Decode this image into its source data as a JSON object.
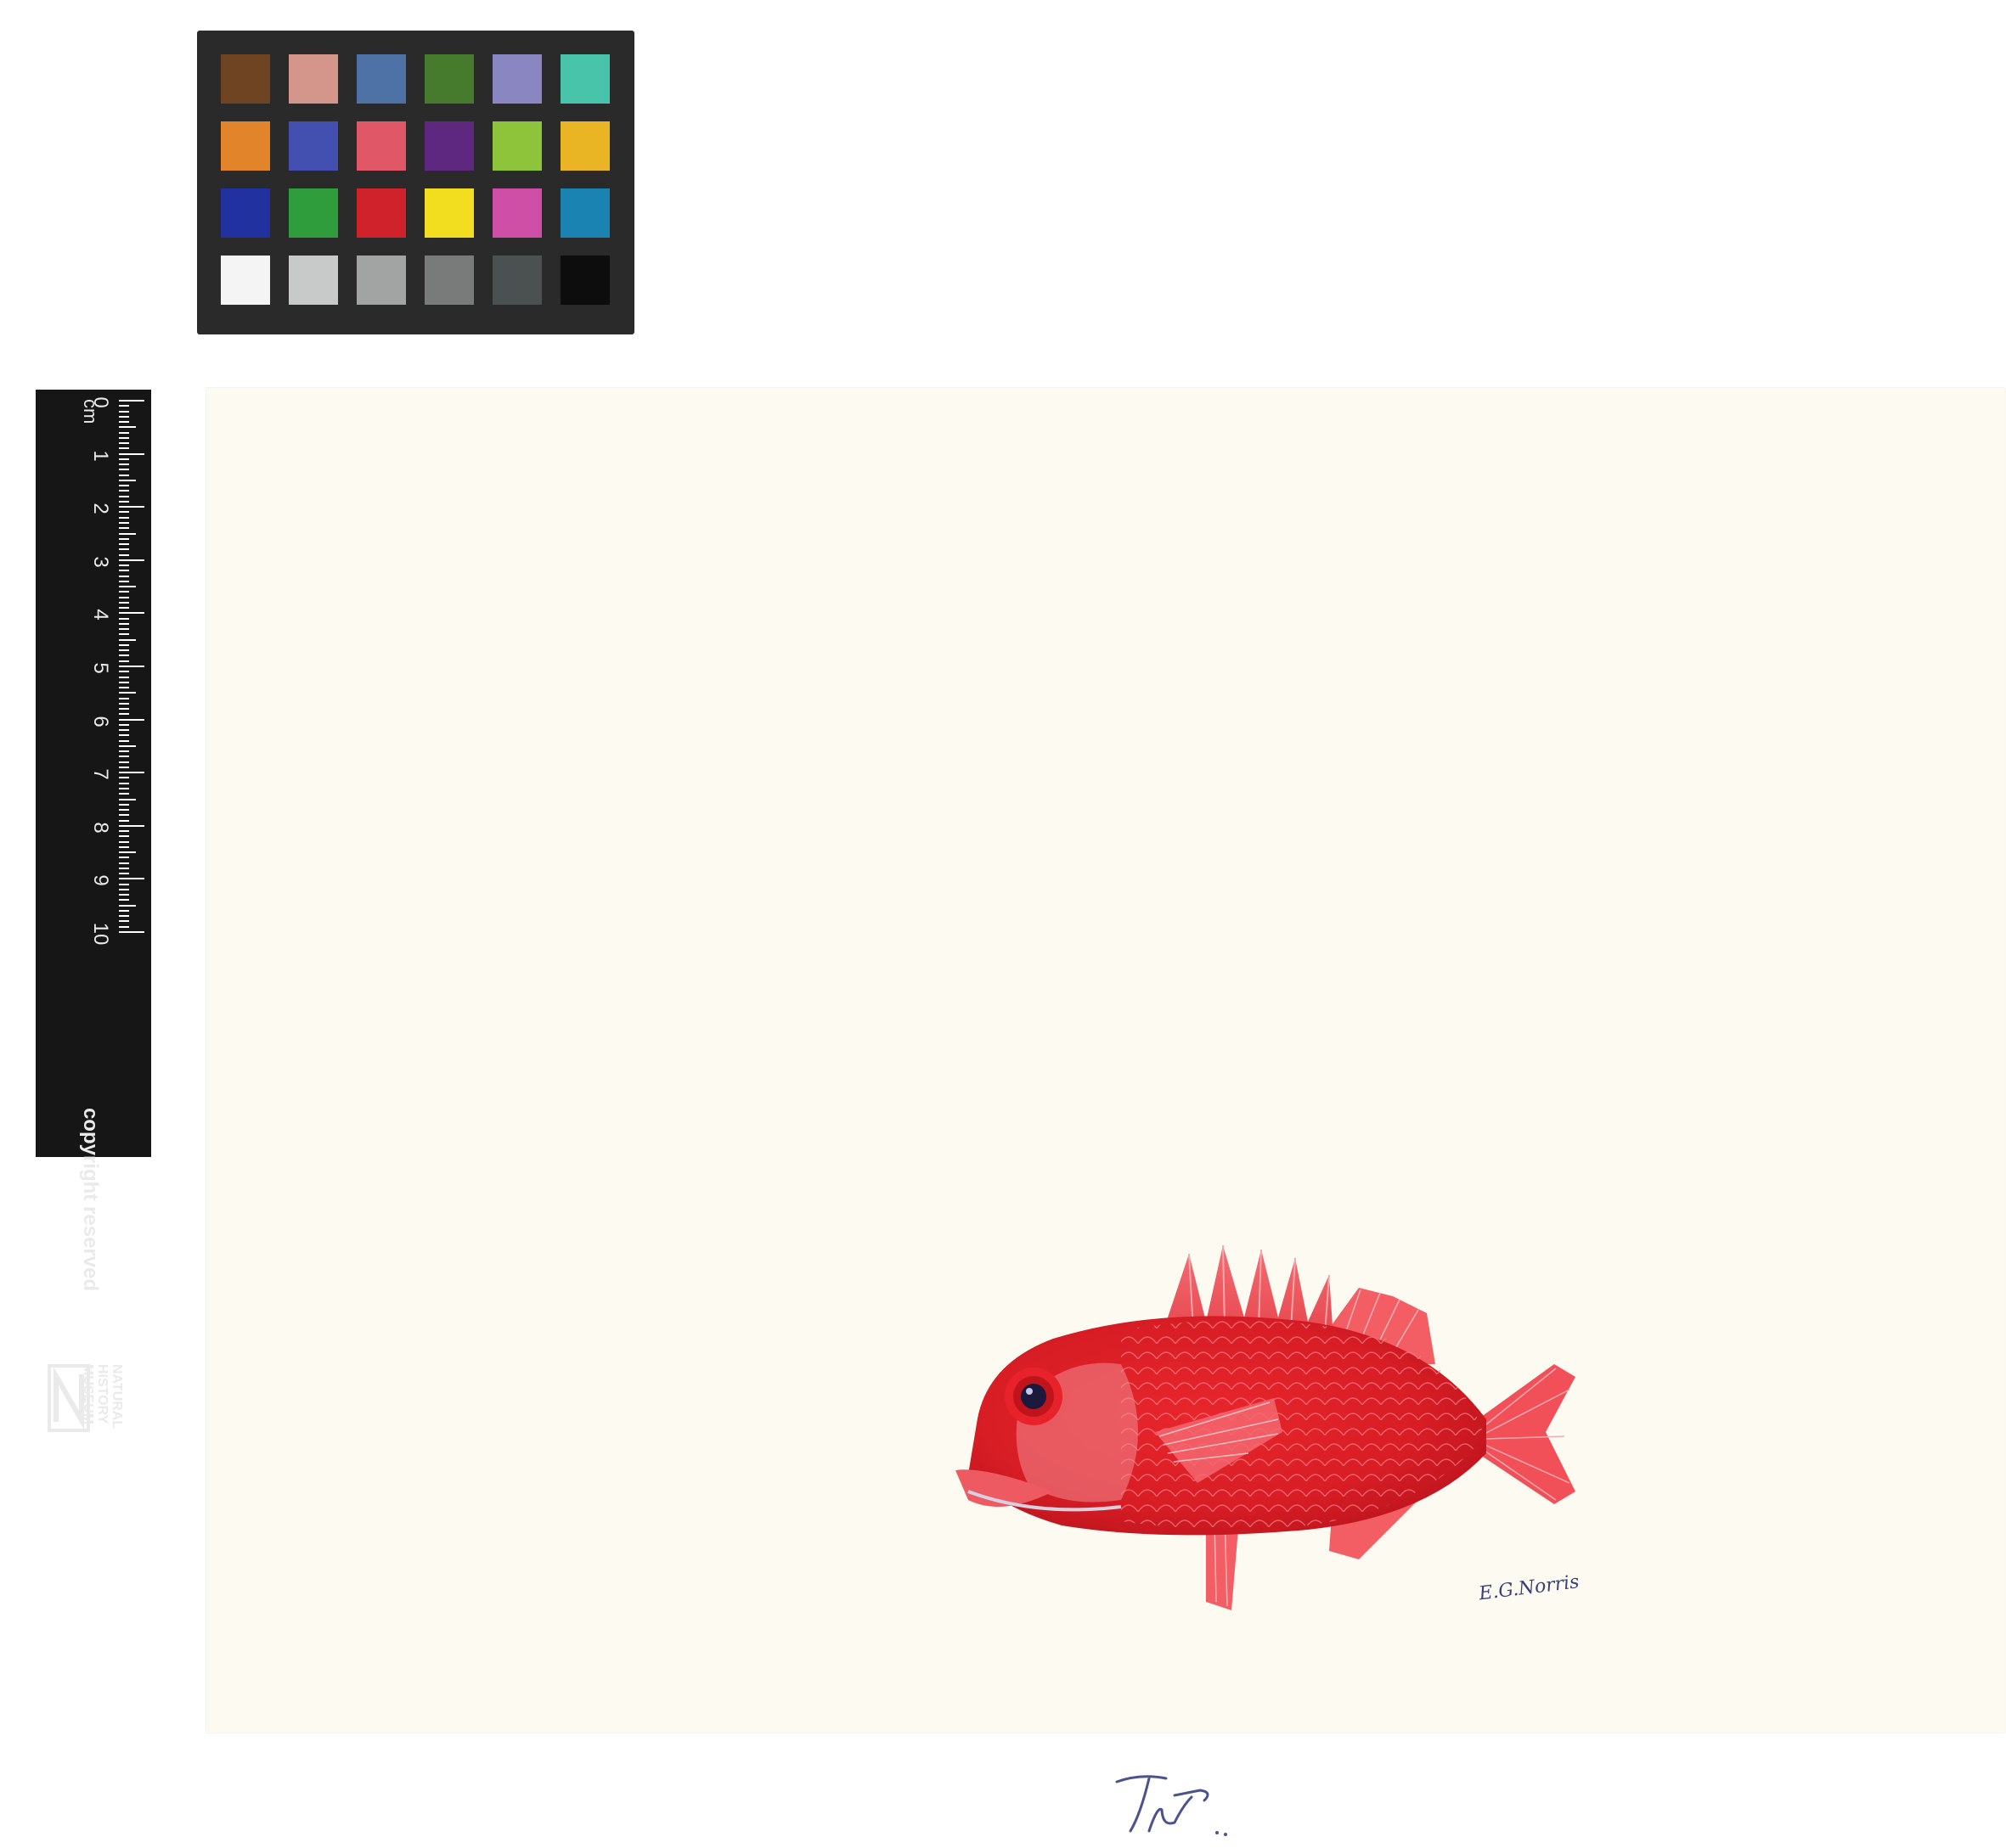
{
  "color_checker": {
    "swatches": [
      "#6f4422",
      "#d4958a",
      "#4f72a6",
      "#467a2c",
      "#8a86c1",
      "#47c4aa",
      "#e2852a",
      "#4450b0",
      "#e05768",
      "#5e2780",
      "#8ec43a",
      "#e9b524",
      "#2231a0",
      "#2f9d3c",
      "#d0222a",
      "#f2dd1e",
      "#d04fa6",
      "#1b83b1",
      "#f4f4f4",
      "#c8c9c9",
      "#a2a3a3",
      "#797a7a",
      "#4a5150",
      "#0d0d0d"
    ]
  },
  "ruler": {
    "unit": "cm",
    "numbers": [
      "0",
      "1",
      "2",
      "3",
      "4",
      "5",
      "6",
      "7",
      "8",
      "9",
      "10"
    ],
    "copyright": "copyright reserved",
    "museum_lines": [
      "NATURAL",
      "HISTORY",
      "MUSEUM"
    ]
  },
  "painting": {
    "subject": "fish-illustration",
    "fish_colors": {
      "body": "#e0222a",
      "fins": "#f04650",
      "highlight": "#f7b6b0",
      "eye": "#1b1a3c"
    },
    "artist_signature": "E.G.Norris",
    "pencil_mark": "Nu"
  }
}
